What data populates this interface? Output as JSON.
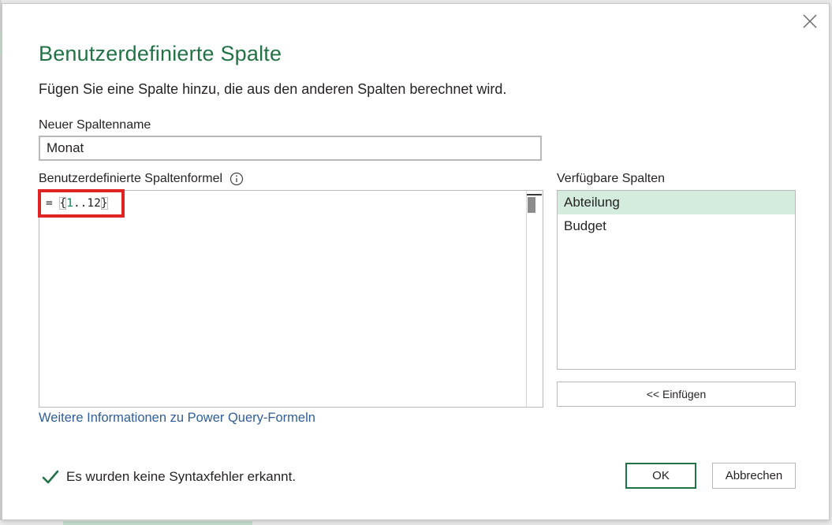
{
  "dialog": {
    "title": "Benutzerdefinierte Spalte",
    "subtitle": "Fügen Sie eine Spalte hinzu, die aus den anderen Spalten berechnet wird.",
    "close_icon": "close-icon"
  },
  "column_name": {
    "label": "Neuer Spaltenname",
    "value": "Monat"
  },
  "formula": {
    "label": "Benutzerdefinierte Spaltenformel",
    "info_icon": "info-icon",
    "prefix": "= ",
    "open_brace": "{",
    "start": "1",
    "range_op": "..",
    "end": "12",
    "close_brace": "}"
  },
  "available_columns": {
    "label": "Verfügbare Spalten",
    "items": [
      {
        "label": "Abteilung",
        "selected": true
      },
      {
        "label": "Budget",
        "selected": false
      }
    ],
    "insert_label": "<< Einfügen"
  },
  "help_link": "Weitere Informationen zu Power Query-Formeln",
  "status": {
    "icon": "checkmark-icon",
    "text": "Es wurden keine Syntaxfehler erkannt."
  },
  "buttons": {
    "ok": "OK",
    "cancel": "Abbrechen"
  },
  "colors": {
    "accent": "#217346",
    "highlight": "#e02424",
    "selected_row": "#d3ecde",
    "link": "#2f5e9a"
  }
}
